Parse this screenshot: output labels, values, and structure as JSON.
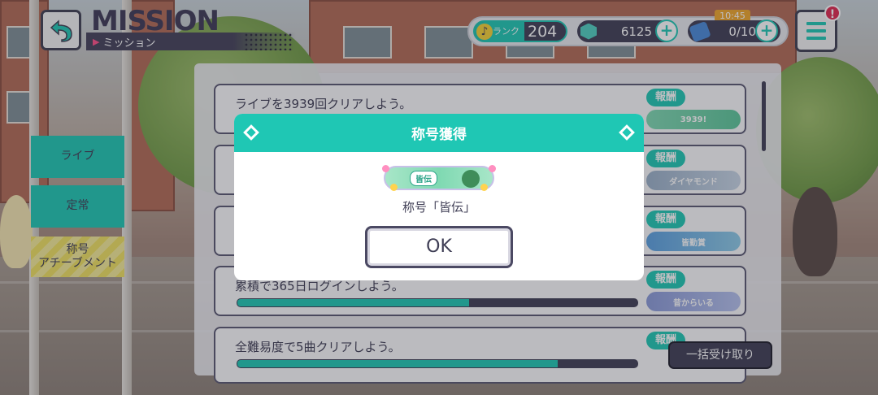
{
  "header": {
    "title_en": "MISSION",
    "title_jp": "ミッション",
    "rank_label": "ランク",
    "rank_value": "204",
    "gems": "6125",
    "caps": "0/10",
    "timer": "10:45",
    "alert": "!"
  },
  "tabs": [
    {
      "label": "ライブ"
    },
    {
      "label": "定常"
    },
    {
      "label_line1": "称号",
      "label_line2": "アチーブメント"
    }
  ],
  "missions": [
    {
      "text": "ライブを3939回クリアしよう。",
      "reward_tag": "報酬",
      "reward": "3939!",
      "progress": 0.55
    },
    {
      "text": "",
      "reward_tag": "報酬",
      "reward": "ダイヤモンド",
      "progress": 0.55
    },
    {
      "text": "",
      "reward_tag": "報酬",
      "reward": "皆勤賞",
      "progress": 0.55
    },
    {
      "text": "累積で365日ログインしよう。",
      "reward_tag": "報酬",
      "reward": "昔からいる",
      "progress": 0.58
    },
    {
      "text": "全難易度で5曲クリアしよう。",
      "reward_tag": "報酬",
      "reward": "",
      "progress": 0.8
    }
  ],
  "bulk_receive": "一括受け取り",
  "modal": {
    "title": "称号獲得",
    "badge_label": "皆伝",
    "message": "称号「皆伝」",
    "ok": "OK"
  },
  "colors": {
    "accent": "#1fc7b4",
    "dark": "#3f3e55",
    "yellow_tab": "#efe160"
  }
}
